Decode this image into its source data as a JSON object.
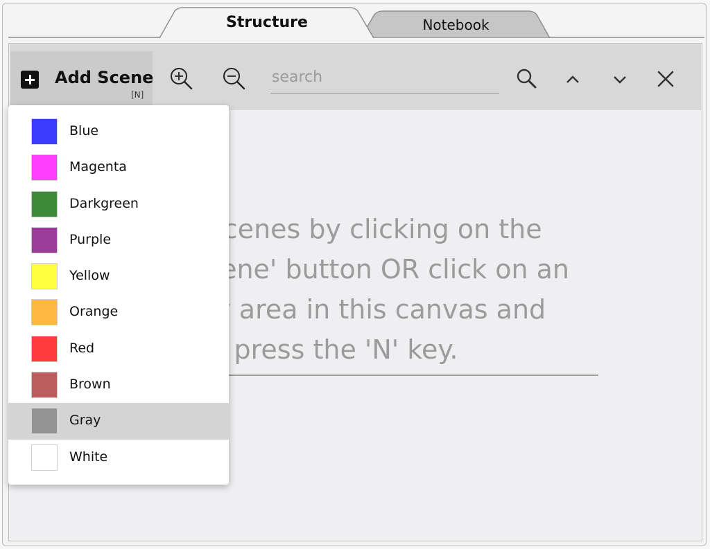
{
  "tabs": [
    {
      "label": "Structure",
      "active": true
    },
    {
      "label": "Notebook",
      "active": false
    }
  ],
  "toolbar": {
    "add_scene_label": "Add Scene",
    "add_scene_shortcut": "[N]",
    "search_placeholder": "search",
    "icons": [
      "plus-icon",
      "zoom-in-icon",
      "zoom-out-icon",
      "search-icon",
      "chevron-up-icon",
      "chevron-down-icon",
      "close-icon"
    ]
  },
  "canvas": {
    "message_lines": [
      "Add scenes by clicking on the",
      "'Add Scene' button OR click on an",
      "empty area in this canvas and",
      "press the 'N' key."
    ]
  },
  "color_menu": {
    "items": [
      {
        "label": "Blue",
        "color": "#3b3bff"
      },
      {
        "label": "Magenta",
        "color": "#ff3dff"
      },
      {
        "label": "Darkgreen",
        "color": "#3a8a3a"
      },
      {
        "label": "Purple",
        "color": "#9a3d9a"
      },
      {
        "label": "Yellow",
        "color": "#ffff3f"
      },
      {
        "label": "Orange",
        "color": "#ffb940"
      },
      {
        "label": "Red",
        "color": "#ff3b3b"
      },
      {
        "label": "Brown",
        "color": "#bd5e5e"
      },
      {
        "label": "Gray",
        "color": "#939393",
        "selected": true
      },
      {
        "label": "White",
        "color": "#ffffff"
      }
    ]
  }
}
